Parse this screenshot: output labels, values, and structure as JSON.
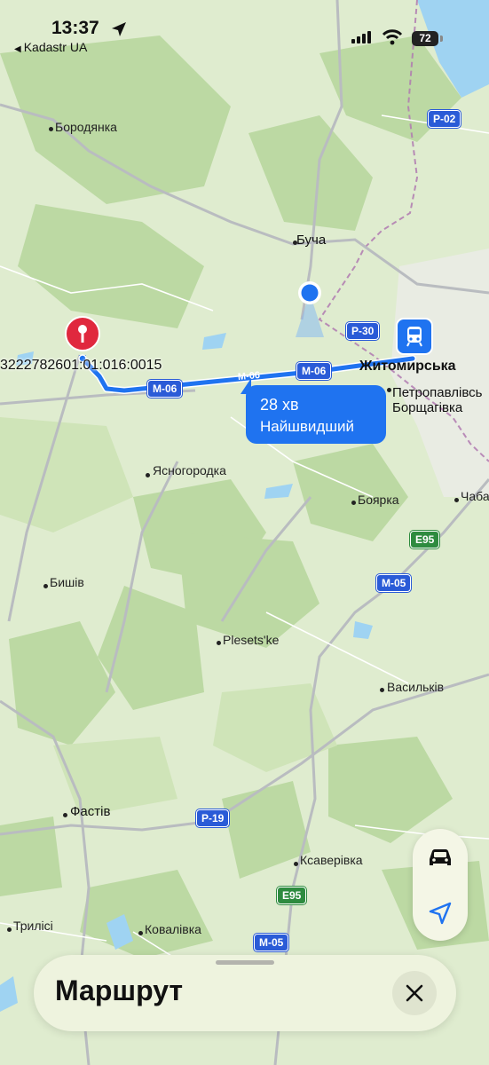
{
  "status_bar": {
    "time": "13:37",
    "back_app": "Kadastr UA",
    "battery": "72"
  },
  "map": {
    "labels": {
      "borodianka": "Бородянка",
      "bucha": "Буча",
      "zhytomyrska": "Житомирська",
      "petropavlivska": "Петропавлівсь",
      "borshchahivka": "Борщагівка",
      "yasnohorodka": "Ясногородка",
      "boyarka": "Боярка",
      "chaba": "Чаба",
      "byshiv": "Бишів",
      "plesetske": "Plesets'ke",
      "vasylkiv": "Васильків",
      "fastiv": "Фастів",
      "ksaverivka": "Ксаверівка",
      "kovalivka": "Ковалівка",
      "tryllisy": "Трилісі"
    },
    "parcel_label": "3222782601:01:016:0015",
    "road_shields": {
      "p02": "P-02",
      "p30": "P-30",
      "m06_a": "M-06",
      "m06_b": "M-06",
      "m06_route": "M-06",
      "e95_a": "E95",
      "m05_a": "M-05",
      "p19": "P-19",
      "e95_b": "E95",
      "m05_b": "M-05"
    },
    "route_callout": {
      "duration": "28 хв",
      "tag": "Найшвидший"
    }
  },
  "controls": {
    "car_icon": "car-icon",
    "location_icon": "location-arrow-icon"
  },
  "sheet": {
    "title": "Маршрут",
    "close_icon": "close-icon"
  },
  "colors": {
    "route": "#1f73f0",
    "land": "#dfeccf",
    "forest": "#b9d8a0",
    "water": "#9fd3f2",
    "pin": "#e0283e"
  }
}
